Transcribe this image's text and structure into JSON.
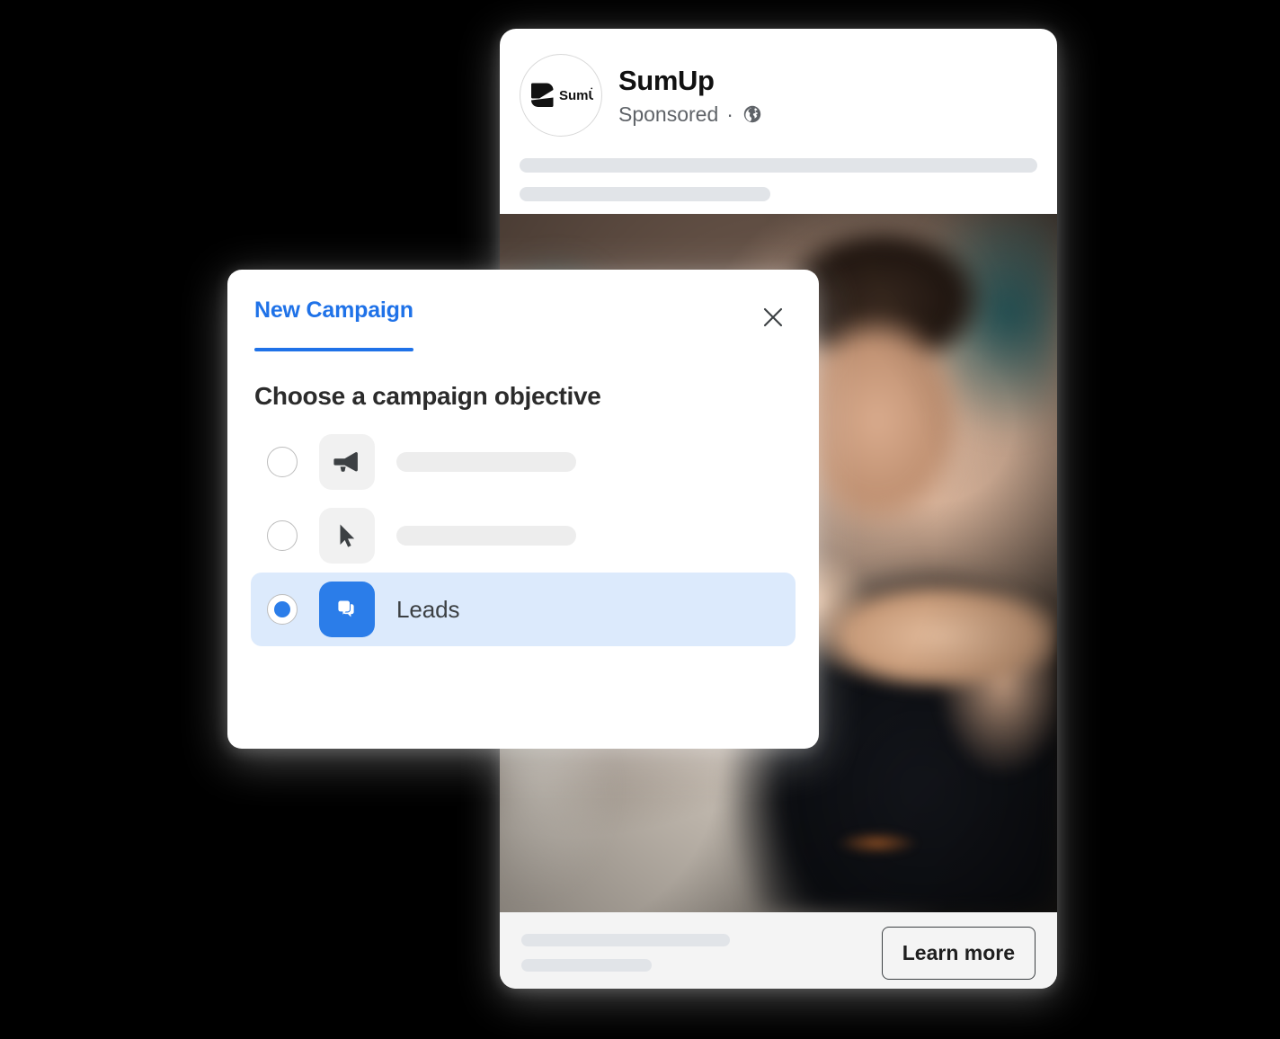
{
  "background_color": "#000000",
  "ad_preview": {
    "brand": {
      "name": "SumUp",
      "logo_text": "SumUp",
      "avatar_icon": "sumup-logo-icon"
    },
    "sponsored_label": "Sponsored",
    "separator": "·",
    "audience_icon": "globe-icon",
    "body_placeholders": [
      {
        "name": "body-line-1",
        "width": "100%"
      },
      {
        "name": "body-line-2",
        "width": "48.5%"
      }
    ],
    "media": {
      "icon": "ad-photo",
      "description": "Photo of a man in a dark shirt with a metal wristwatch in a shop"
    },
    "footer": {
      "placeholders": [
        {
          "name": "footer-line-1",
          "width": "61%"
        },
        {
          "name": "footer-line-2",
          "width": "38%"
        }
      ],
      "cta_label": "Learn more"
    }
  },
  "campaign_dialog": {
    "tab_label": "New Campaign",
    "close_icon": "close-icon",
    "heading": "Choose a campaign objective",
    "accent_color": "#1f72e8",
    "selected_row_color": "#dceafc",
    "options": [
      {
        "id": "awareness",
        "icon": "megaphone-icon",
        "label": "",
        "label_is_placeholder": true,
        "selected": false
      },
      {
        "id": "traffic",
        "icon": "cursor-arrow-icon",
        "label": "",
        "label_is_placeholder": true,
        "selected": false
      },
      {
        "id": "leads",
        "icon": "chat-bubbles-icon",
        "label": "Leads",
        "label_is_placeholder": false,
        "selected": true
      }
    ]
  }
}
